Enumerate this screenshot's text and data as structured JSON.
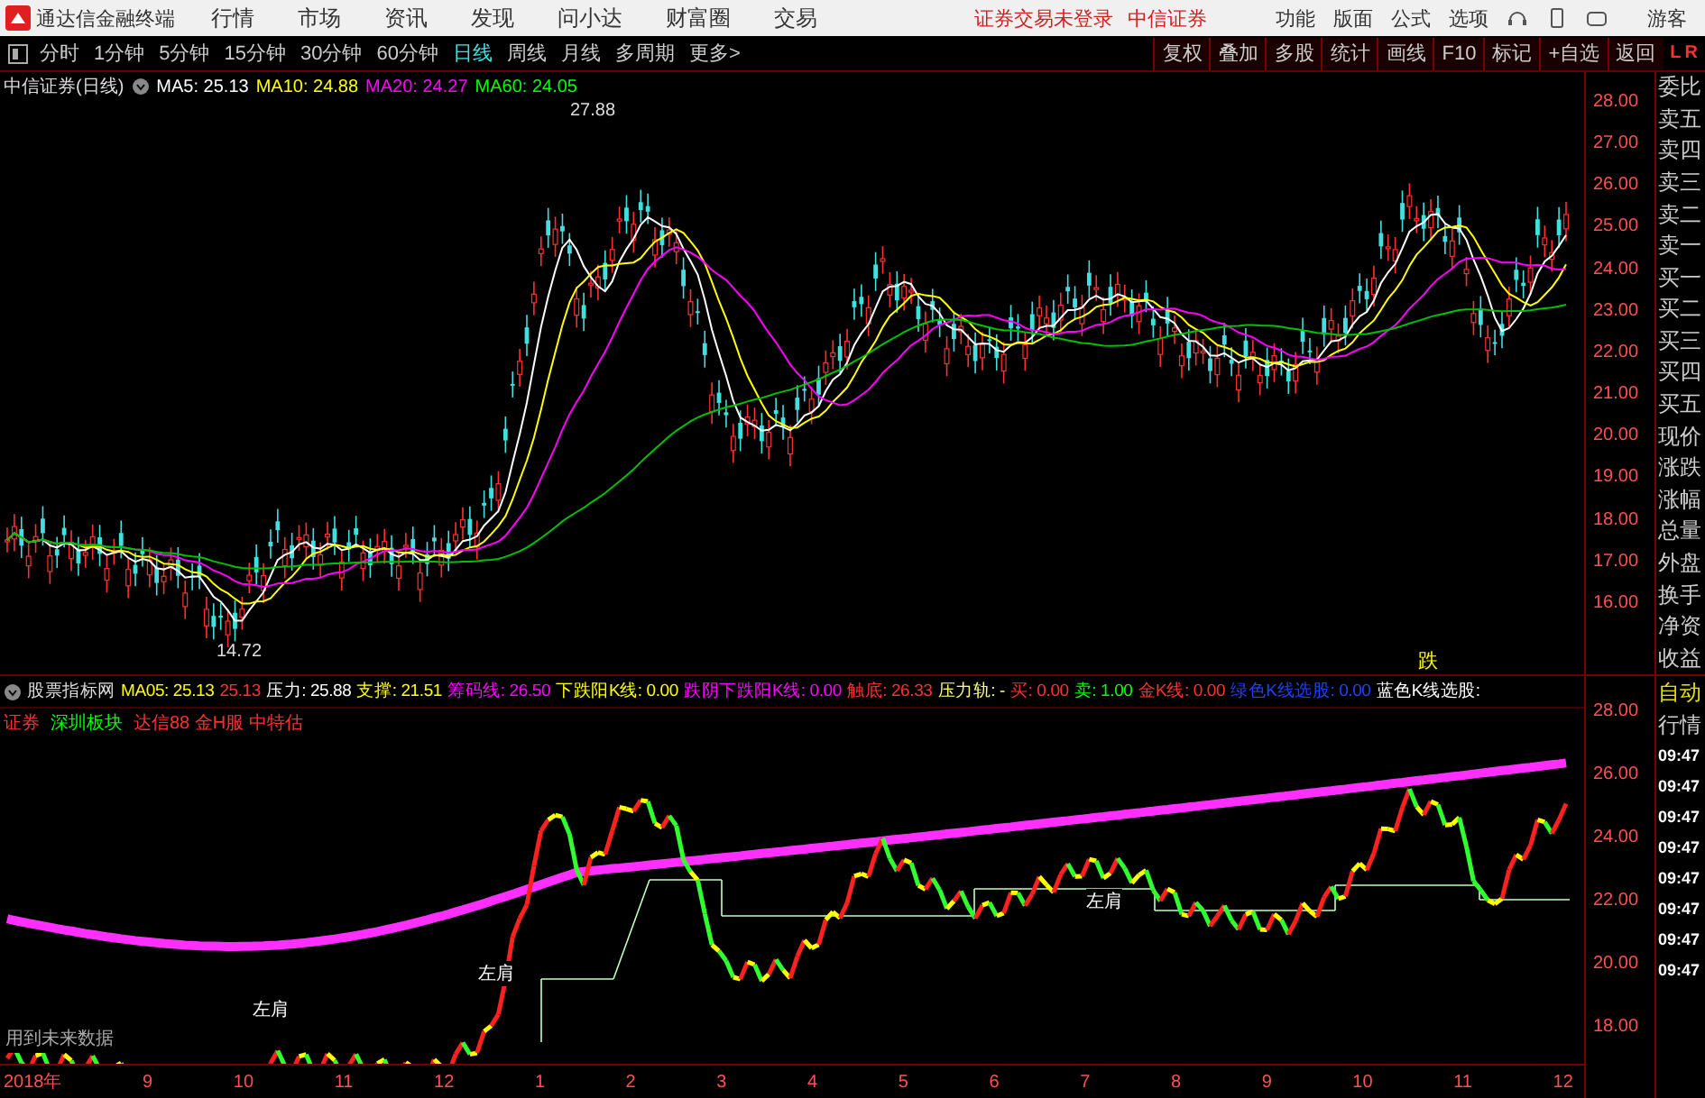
{
  "title_bar": {
    "app_name": "通达信金融终端",
    "menu": [
      "行情",
      "市场",
      "资讯",
      "发现",
      "问小达",
      "财富圈",
      "交易"
    ],
    "status": [
      "证券交易未登录",
      "中信证券"
    ],
    "right_menu": [
      "功能",
      "版面",
      "公式",
      "选项"
    ],
    "user": "游客"
  },
  "period_bar": {
    "periods": [
      {
        "label": "分时",
        "selected": false
      },
      {
        "label": "1分钟",
        "selected": false
      },
      {
        "label": "5分钟",
        "selected": false
      },
      {
        "label": "15分钟",
        "selected": false
      },
      {
        "label": "30分钟",
        "selected": false
      },
      {
        "label": "60分钟",
        "selected": false
      },
      {
        "label": "日线",
        "selected": true
      },
      {
        "label": "周线",
        "selected": false
      },
      {
        "label": "月线",
        "selected": false
      },
      {
        "label": "多周期",
        "selected": false
      },
      {
        "label": "更多>",
        "selected": false
      }
    ],
    "tools": [
      "复权",
      "叠加",
      "多股",
      "统计",
      "画线",
      "F10",
      "标记",
      "+自选",
      "返回"
    ],
    "corner": [
      "L",
      "R"
    ]
  },
  "main_chart": {
    "title": "中信证券(日线)",
    "ma": [
      {
        "text": "MA5: 25.13",
        "color": "#ffffff"
      },
      {
        "text": "MA10: 24.88",
        "color": "#ffff00"
      },
      {
        "text": "MA20: 24.27",
        "color": "#ff00ff"
      },
      {
        "text": "MA60: 24.05",
        "color": "#00ff00"
      }
    ],
    "high_label": "27.88",
    "low_label": "14.72",
    "signal": "跌",
    "price_axis": [
      "28.00",
      "27.00",
      "26.00",
      "25.00",
      "24.00",
      "23.00",
      "22.00",
      "21.00",
      "20.00",
      "19.00",
      "18.00",
      "17.00",
      "16.00"
    ]
  },
  "indicator": {
    "name": "股票指标网",
    "values": [
      {
        "text": "MA05: 25.13",
        "color": "#ffff00"
      },
      {
        "text": "25.13",
        "color": "#ff3030"
      },
      {
        "text": "压力: 25.88",
        "color": "#ffffff"
      },
      {
        "text": "支撑: 21.51",
        "color": "#ffff00"
      },
      {
        "text": "筹码线: 26.50",
        "color": "#ff00ff"
      },
      {
        "text": "下跌阳K线: 0.00",
        "color": "#ffff00"
      },
      {
        "text": "跌阴下跌阳K线: 0.00",
        "color": "#ff00ff"
      },
      {
        "text": "触底: 26.33",
        "color": "#ff3030"
      },
      {
        "text": "压力轨: -",
        "color": "#ffff80"
      },
      {
        "text": "买: 0.00",
        "color": "#ff3030"
      },
      {
        "text": "卖: 1.00",
        "color": "#00ff00"
      },
      {
        "text": "金K线: 0.00",
        "color": "#ff3030"
      },
      {
        "text": "绿色K线选股: 0.00",
        "color": "#2040ff"
      },
      {
        "text": "蓝色K线选股:",
        "color": "#ffffff"
      }
    ],
    "line2": [
      {
        "text": "证券",
        "color": "#ff3030"
      },
      {
        "text": "深圳板块",
        "color": "#00ff00"
      },
      {
        "text": "达信88 金H服 中特估",
        "color": "#ff3030"
      }
    ],
    "annotations": [
      "左肩",
      "左肩",
      "左肩"
    ],
    "note": "用到未来数据",
    "axis": [
      "28.00",
      "26.00",
      "24.00",
      "22.00",
      "20.00",
      "18.00"
    ]
  },
  "side_panel": {
    "quote_labels": [
      "委比",
      "卖五",
      "卖四",
      "卖三",
      "卖二",
      "卖一",
      "买一",
      "买二",
      "买三",
      "买四",
      "买五",
      "现价",
      "涨跌",
      "涨幅",
      "总量",
      "外盘",
      "换手",
      "净资",
      "收益"
    ],
    "tabs": [
      "自动",
      "行情"
    ],
    "times": [
      "09:47",
      "09:47",
      "09:47",
      "09:47",
      "09:47",
      "09:47",
      "09:47",
      "09:47"
    ]
  },
  "x_axis": [
    "2018年",
    "9",
    "10",
    "11",
    "12",
    "1",
    "2",
    "3",
    "4",
    "5",
    "6",
    "7",
    "8",
    "9",
    "10",
    "11",
    "12"
  ]
}
